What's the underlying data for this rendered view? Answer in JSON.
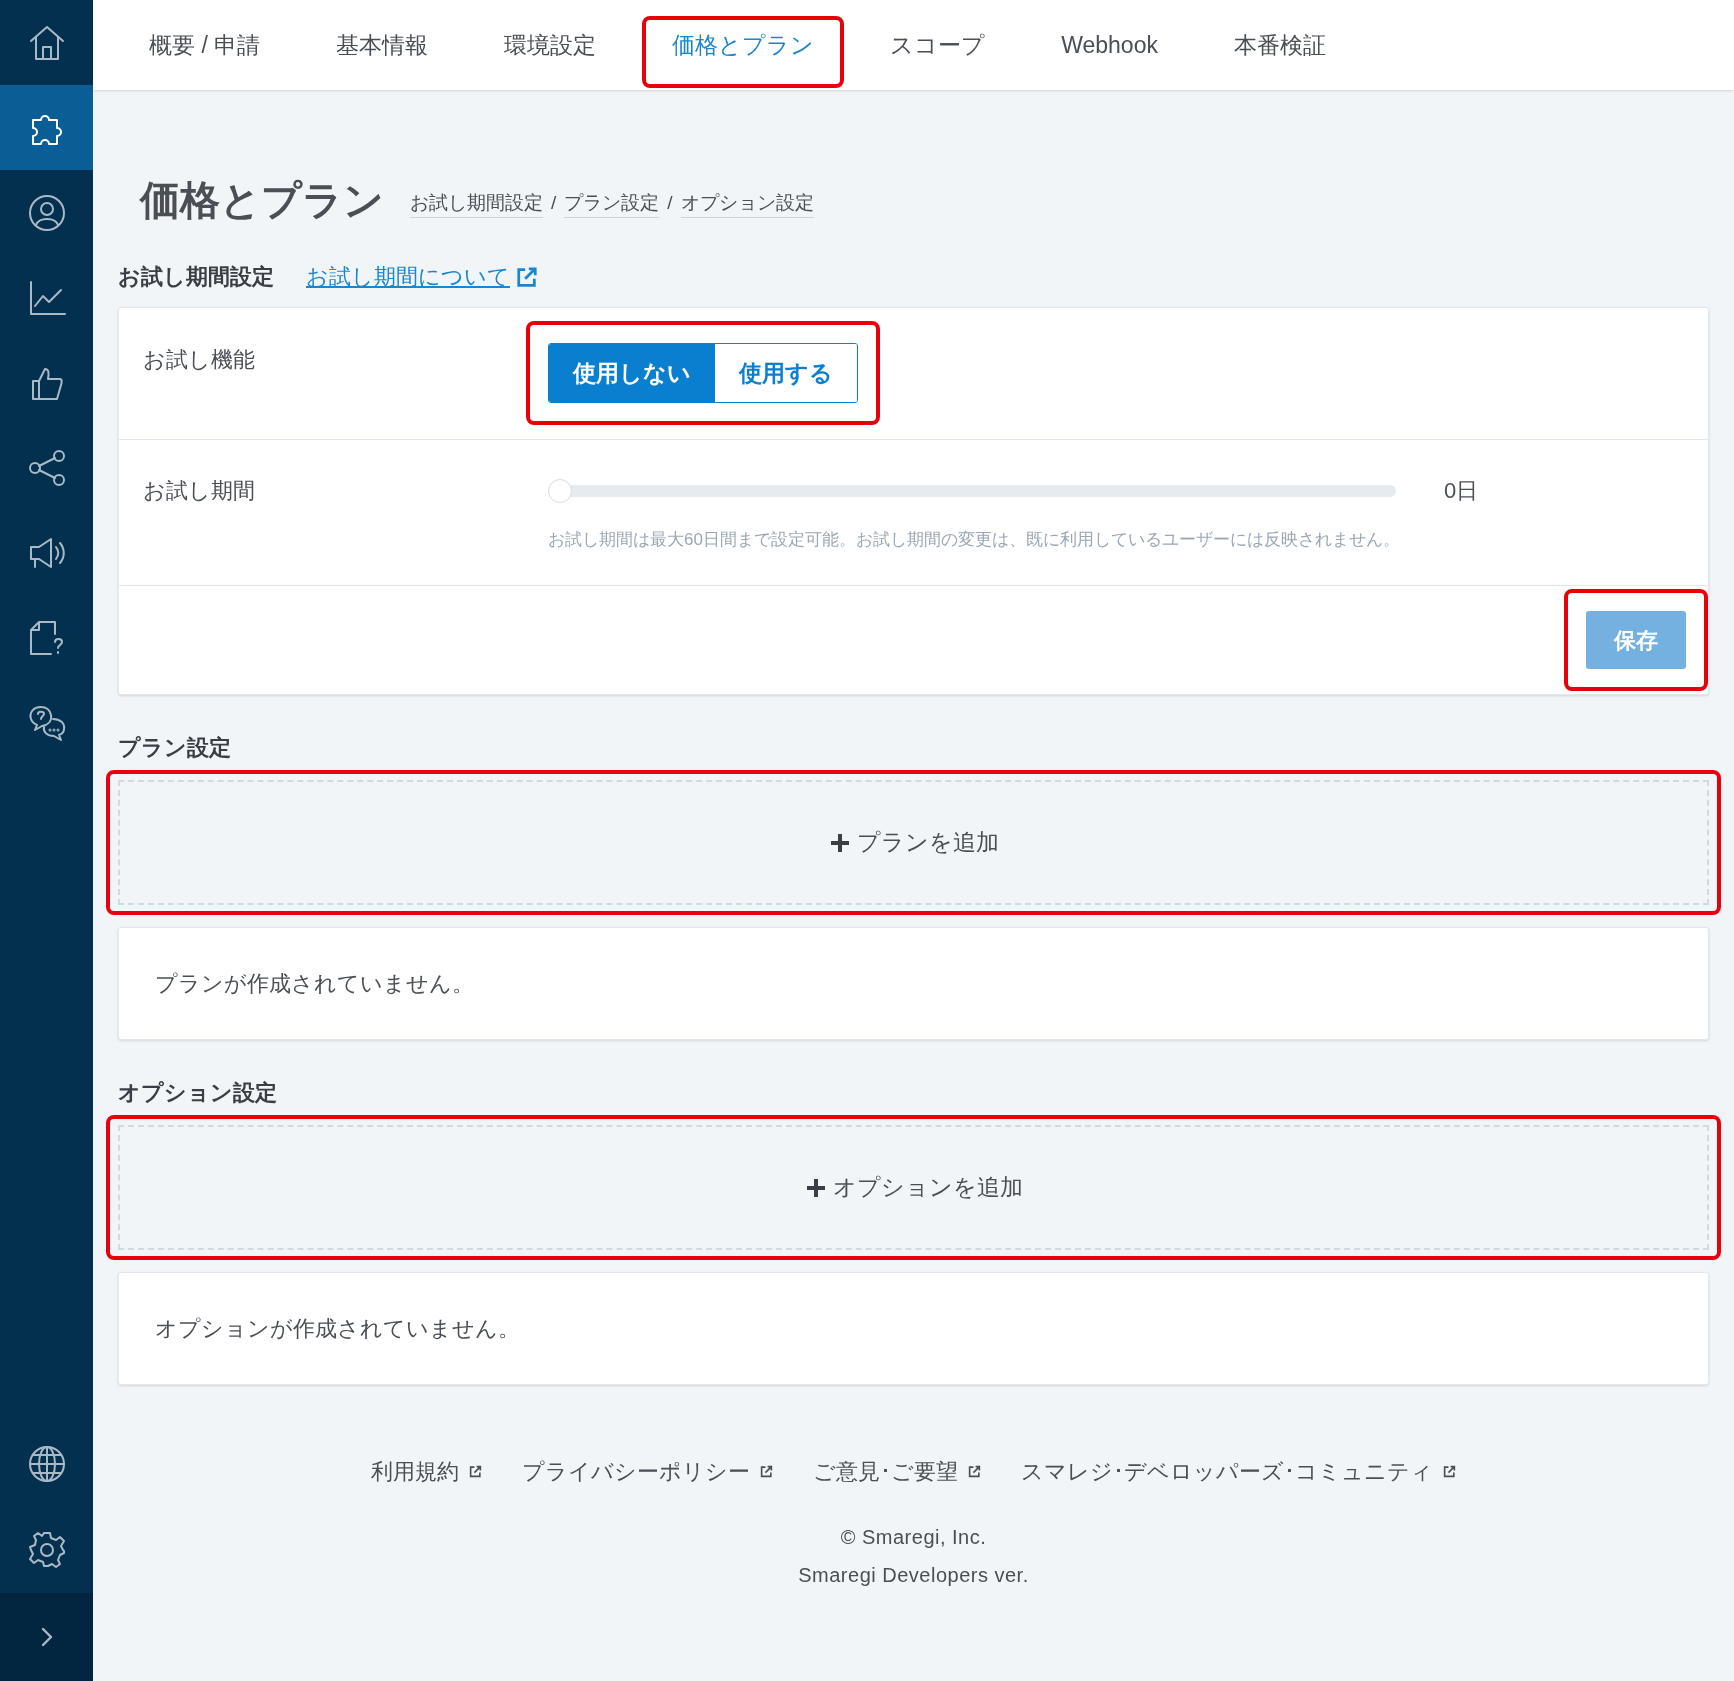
{
  "sidebar": {
    "items": [
      {
        "selected": false
      },
      {
        "selected": true
      },
      {
        "selected": false
      },
      {
        "selected": false
      },
      {
        "selected": false
      },
      {
        "selected": false
      },
      {
        "selected": false
      },
      {
        "selected": false
      },
      {
        "selected": false
      }
    ]
  },
  "tabs": [
    {
      "label": "概要 / 申請",
      "selected": false,
      "highlighted": false
    },
    {
      "label": "基本情報",
      "selected": false,
      "highlighted": false
    },
    {
      "label": "環境設定",
      "selected": false,
      "highlighted": false
    },
    {
      "label": "価格とプラン",
      "selected": true,
      "highlighted": true
    },
    {
      "label": "スコープ",
      "selected": false,
      "highlighted": false
    },
    {
      "label": "Webhook",
      "selected": false,
      "highlighted": false
    },
    {
      "label": "本番検証",
      "selected": false,
      "highlighted": false
    }
  ],
  "page": {
    "title": "価格とプラン",
    "anchors": [
      "お試し期間設定",
      "プラン設定",
      "オプション設定"
    ],
    "separator": "/"
  },
  "trial": {
    "heading": "お試し期間設定",
    "help_link": "お試し期間について",
    "feature": {
      "label": "お試し機能",
      "highlighted": true,
      "options": [
        {
          "label": "使用しない",
          "selected": true
        },
        {
          "label": "使用する",
          "selected": false
        }
      ]
    },
    "period": {
      "label": "お試し期間",
      "level": 0,
      "reading": "0日",
      "hint": "お試し期間は最大60日間まで設定可能。お試し期間の変更は、既に利用しているユーザーには反映されません。"
    },
    "save": {
      "label": "保存",
      "disabled": true,
      "highlighted": true
    }
  },
  "plans": {
    "heading": "プラン設定",
    "add": {
      "label": "プランを追加",
      "highlighted": true
    },
    "empty": "プランが作成されていません。"
  },
  "options": {
    "heading": "オプション設定",
    "add": {
      "label": "オプションを追加",
      "highlighted": true
    },
    "empty": "オプションが作成されていません。"
  },
  "footer": {
    "links": [
      "利用規約",
      "プライバシーポリシー",
      "ご意見･ご要望",
      "スマレジ･デベロッパーズ･コミュニティ"
    ],
    "copyright": "© Smaregi, Inc.",
    "version": "Smaregi Developers ver."
  }
}
